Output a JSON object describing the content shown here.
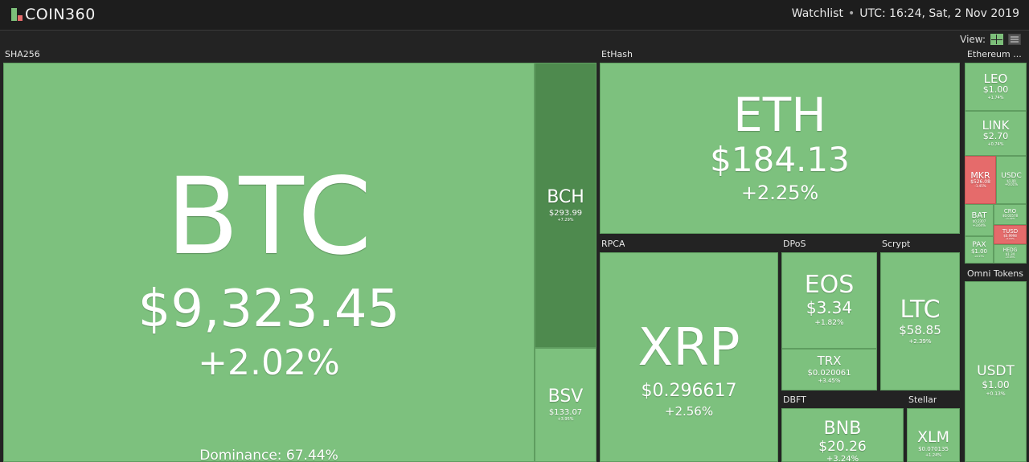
{
  "header": {
    "logo_text": "COIN360",
    "watchlist_label": "Watchlist",
    "separator": "•",
    "datetime": "UTC: 16:24, Sat, 2 Nov 2019"
  },
  "view": {
    "label": "View:",
    "options": [
      "treemap",
      "list"
    ],
    "selected": "treemap"
  },
  "groups": {
    "sha256": "SHA256",
    "ethash": "EtHash",
    "ethereum": "Ethereum ...",
    "rpca": "RPCA",
    "dpos": "DPoS",
    "scrypt": "Scrypt",
    "omni": "Omni Tokens",
    "dbft": "DBFT",
    "stellar": "Stellar"
  },
  "colors": {
    "up": "#7dc17e",
    "up_dark": "#4e8a4e",
    "down": "#e56b6b",
    "background": "#232323"
  },
  "coins": {
    "btc": {
      "symbol": "BTC",
      "price": "$9,323.45",
      "change": "+2.02%",
      "dominance": "Dominance: 67.44%"
    },
    "bch": {
      "symbol": "BCH",
      "price": "$293.99",
      "change": "+7.29%"
    },
    "bsv": {
      "symbol": "BSV",
      "price": "$133.07",
      "change": "+3.95%"
    },
    "eth": {
      "symbol": "ETH",
      "price": "$184.13",
      "change": "+2.25%"
    },
    "leo": {
      "symbol": "LEO",
      "price": "$1.00",
      "change": "+1.74%"
    },
    "link": {
      "symbol": "LINK",
      "price": "$2.70",
      "change": "+0.74%"
    },
    "mkr": {
      "symbol": "MKR",
      "price": "$526.08",
      "change": "-1.45%"
    },
    "usdc": {
      "symbol": "USDC",
      "price": "$1.00",
      "change": "+0.01%"
    },
    "bat": {
      "symbol": "BAT",
      "price": "$0.2307",
      "change": "+3.64%"
    },
    "cro": {
      "symbol": "CRO",
      "price": "$0.03578",
      "change": "+1.22%"
    },
    "tusd": {
      "symbol": "TUSD",
      "price": "$0.9998",
      "change": "-0.03%"
    },
    "pax": {
      "symbol": "PAX",
      "price": "$1.00",
      "change": "+0.17%"
    },
    "hedg": {
      "symbol": "HEDG",
      "price": "$1.34",
      "change": "+0.03%"
    },
    "xrp": {
      "symbol": "XRP",
      "price": "$0.296617",
      "change": "+2.56%"
    },
    "eos": {
      "symbol": "EOS",
      "price": "$3.34",
      "change": "+1.82%"
    },
    "trx": {
      "symbol": "TRX",
      "price": "$0.020061",
      "change": "+3.45%"
    },
    "ltc": {
      "symbol": "LTC",
      "price": "$58.85",
      "change": "+2.39%"
    },
    "usdt": {
      "symbol": "USDT",
      "price": "$1.00",
      "change": "+0.13%"
    },
    "bnb": {
      "symbol": "BNB",
      "price": "$20.26",
      "change": "+3.24%"
    },
    "xlm": {
      "symbol": "XLM",
      "price": "$0.070135",
      "change": "+1.24%"
    }
  }
}
